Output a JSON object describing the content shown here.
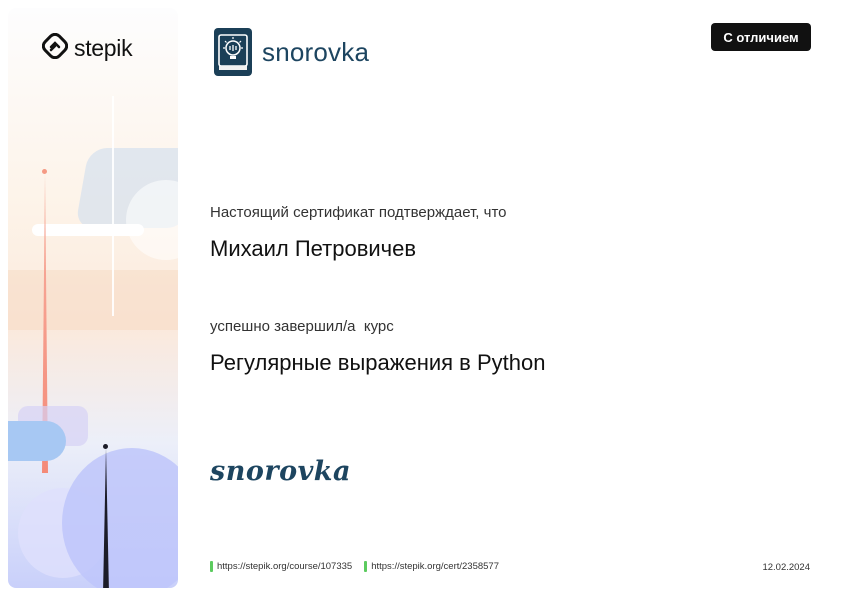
{
  "sidebar": {
    "brand_name": "stepik",
    "brand_icon": "stepik-logo-icon"
  },
  "organization": {
    "name": "snorovka",
    "logo_icon": "book-lightbulb-icon",
    "color": "#1d4560"
  },
  "badge": {
    "label": "С отличием"
  },
  "certificate": {
    "intro": "Настоящий сертификат подтверждает, что",
    "recipient": "Михаил Петровичев",
    "completed_text": "успешно завершил/а  курс",
    "course_title": "Регулярные выражения в Python",
    "signature": "snorovka"
  },
  "footer": {
    "course_url": "https://stepik.org/course/107335",
    "cert_url": "https://stepik.org/cert/2358577",
    "date": "12.02.2024",
    "link_mark_color": "#5ccb5f"
  }
}
